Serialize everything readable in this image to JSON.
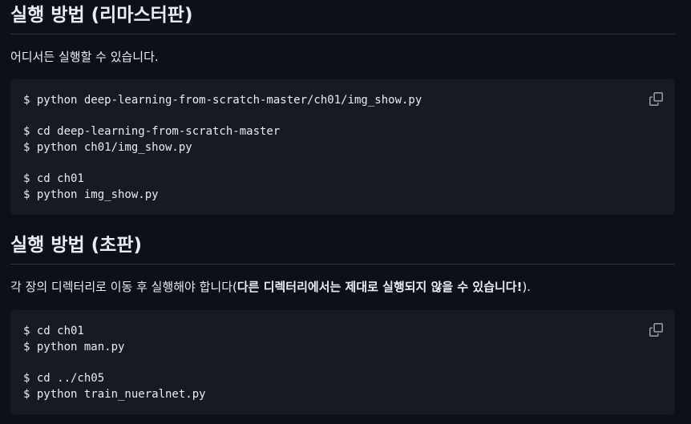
{
  "section1": {
    "heading": "실행 방법 (리마스터판)",
    "description": "어디서든 실행할 수 있습니다.",
    "code": [
      "$ python deep-learning-from-scratch-master/ch01/img_show.py",
      "",
      "$ cd deep-learning-from-scratch-master",
      "$ python ch01/img_show.py",
      "",
      "$ cd ch01",
      "$ python img_show.py"
    ],
    "copy_icon": "copy-icon"
  },
  "section2": {
    "heading": "실행 방법 (초판)",
    "description_plain": "각 장의 디렉터리로 이동 후 실행해야 합니다(",
    "description_bold": "다른 디렉터리에서는 제대로 실행되지 않을 수 있습니다!",
    "description_end": ").",
    "code": [
      "$ cd ch01",
      "$ python man.py",
      "",
      "$ cd ../ch05",
      "$ python train_nueralnet.py"
    ],
    "copy_icon": "copy-icon"
  },
  "colors": {
    "background": "#0d1117",
    "code_background": "#161b22",
    "text": "#e6edf3",
    "divider": "#30363d",
    "icon": "#9198a1"
  }
}
